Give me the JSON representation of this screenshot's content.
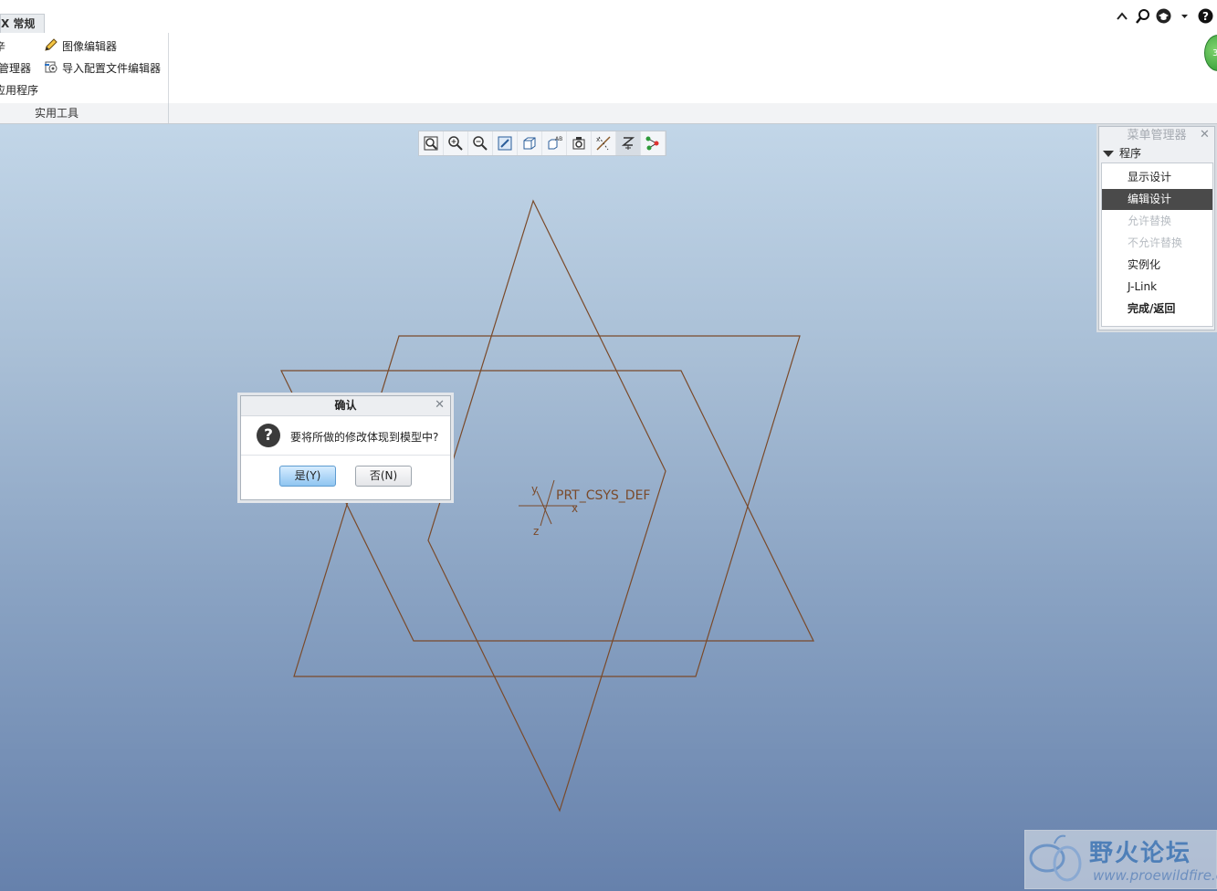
{
  "ribbon": {
    "tab_label": "X 常规",
    "items": [
      {
        "label": "辛",
        "icon": "none"
      },
      {
        "label": "图像编辑器",
        "icon": "pencil-icon"
      },
      {
        "label": "管理器",
        "icon": "none"
      },
      {
        "label": "导入配置文件编辑器",
        "icon": "import-config-icon"
      },
      {
        "label": "应用程序",
        "icon": "none"
      }
    ],
    "group_label": "实用工具"
  },
  "top_right_icons": [
    "caret-up-icon",
    "search-icon",
    "graduation-cap-icon",
    "dropdown-arrow-icon",
    "help-icon"
  ],
  "badge": {
    "text": "3"
  },
  "view_toolbar": {
    "buttons": [
      "refit-icon",
      "zoom-in-icon",
      "zoom-out-icon",
      "repaint-icon",
      "display-style-icon",
      "saved-views-icon",
      "view-manager-icon",
      "datum-display-icon",
      "spin-center-icon",
      "annotation-display-icon"
    ]
  },
  "model": {
    "csys_label": "PRT_CSYS_DEF",
    "axis_x": "x",
    "axis_y": "y",
    "axis_z": "z",
    "line_color": "#7a4a2a"
  },
  "menu_manager": {
    "title": "菜单管理器",
    "section": "程序",
    "items": [
      {
        "label": "显示设计",
        "state": "normal"
      },
      {
        "label": "编辑设计",
        "state": "selected"
      },
      {
        "label": "允许替换",
        "state": "disabled"
      },
      {
        "label": "不允许替换",
        "state": "disabled"
      },
      {
        "label": "实例化",
        "state": "normal"
      },
      {
        "label": "J-Link",
        "state": "normal"
      },
      {
        "label": "完成/返回",
        "state": "bold"
      }
    ]
  },
  "dialog": {
    "title": "确认",
    "message": "要将所做的修改体现到模型中?",
    "yes_label": "是(Y)",
    "no_label": "否(N)"
  },
  "watermark": {
    "title": "野火论坛",
    "url": "www.proewildfire.cn"
  }
}
